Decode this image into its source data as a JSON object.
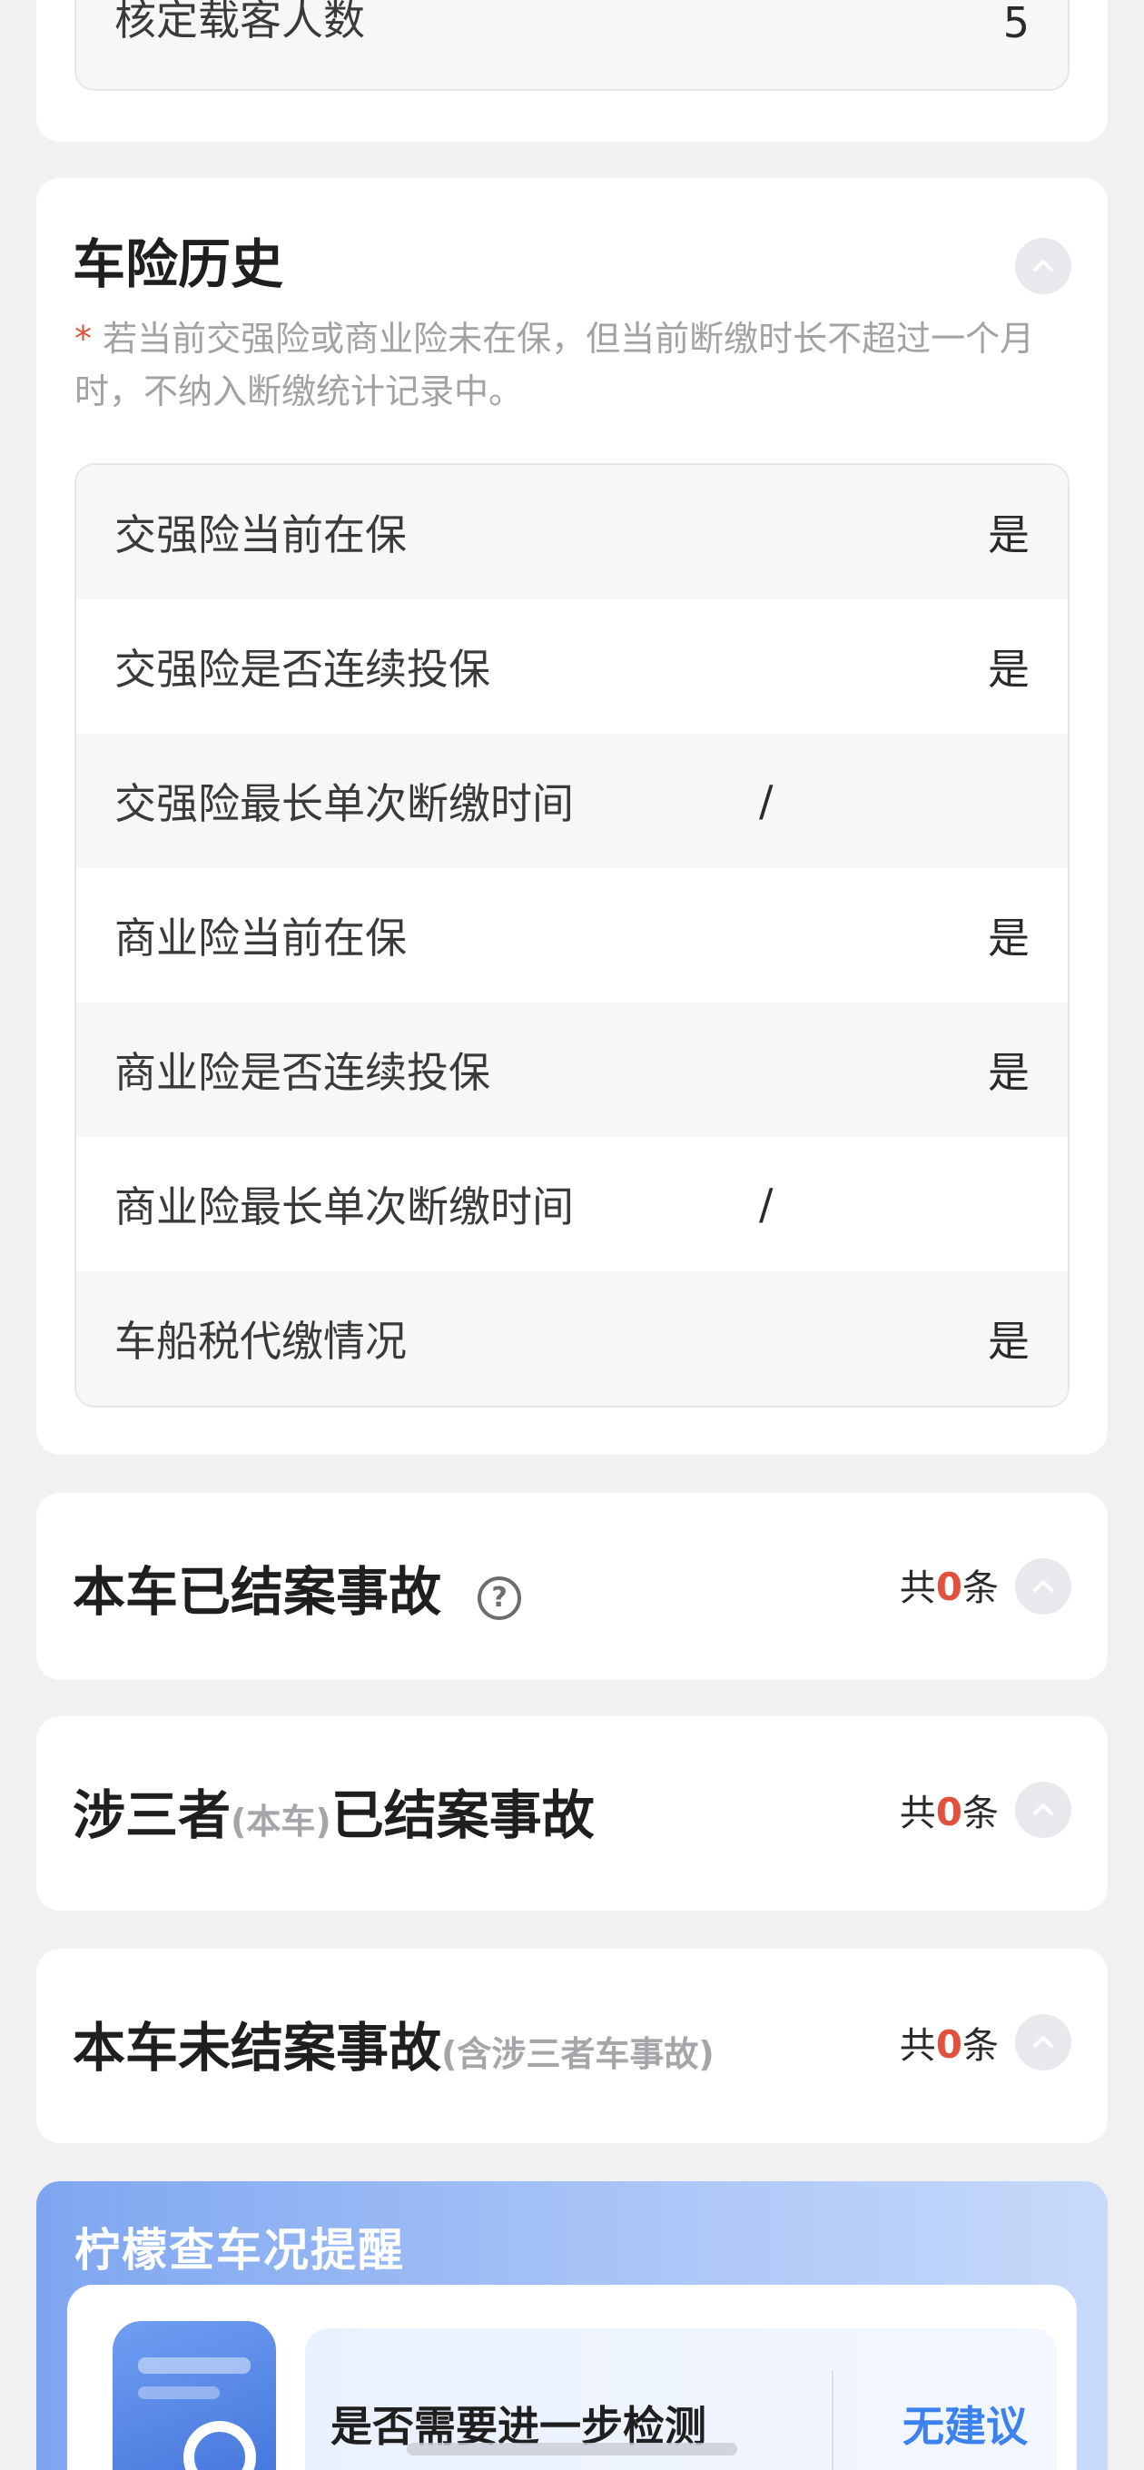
{
  "top_section": {
    "rows": [
      {
        "label": "核定载客人数",
        "value": "5"
      }
    ]
  },
  "insurance_history": {
    "title": "车险历史",
    "note_star": "*",
    "note": " 若当前交强险或商业险未在保，但当前断缴时长不超过一个月时，不纳入断缴统计记录中。",
    "rows": [
      {
        "label": "交强险当前在保",
        "value": "是"
      },
      {
        "label": "交强险是否连续投保",
        "value": "是"
      },
      {
        "label": "交强险最长单次断缴时间",
        "value": "/"
      },
      {
        "label": "商业险当前在保",
        "value": "是"
      },
      {
        "label": "商业险是否连续投保",
        "value": "是"
      },
      {
        "label": "商业险最长单次断缴时间",
        "value": "/"
      },
      {
        "label": "车船税代缴情况",
        "value": "是"
      }
    ]
  },
  "accidents": [
    {
      "title": "本车已结案事故",
      "sub_pre": "",
      "title_post": "",
      "sub_post": "",
      "help": "?",
      "count_prefix": "共",
      "count": "0",
      "count_suffix": "条"
    },
    {
      "title": "涉三者",
      "sub_pre": "(本车)",
      "title_post": "已结案事故",
      "sub_post": "",
      "help": "",
      "count_prefix": "共",
      "count": "0",
      "count_suffix": "条"
    },
    {
      "title": "本车未结案事故",
      "sub_pre": "",
      "title_post": "",
      "sub_post": "(含涉三者车事故)",
      "help": "",
      "count_prefix": "共",
      "count": "0",
      "count_suffix": "条"
    }
  ],
  "reminder": {
    "title": "柠檬查车况提醒",
    "question": "是否需要进一步检测",
    "answer": "无建议"
  },
  "colors": {
    "accent_red": "#e2513d",
    "accent_blue": "#3b82f0",
    "page_bg": "#f1f1f3"
  }
}
